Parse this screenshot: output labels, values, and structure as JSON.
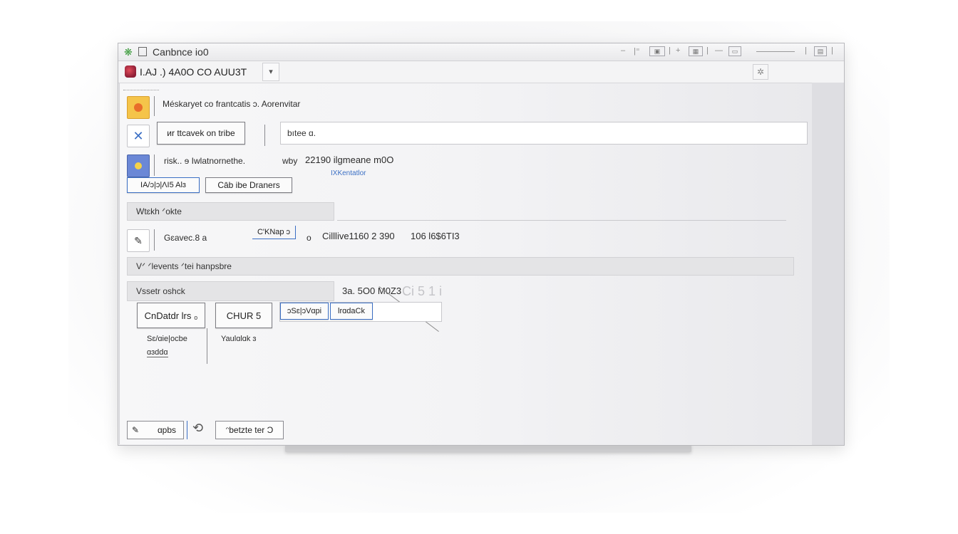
{
  "window": {
    "title": "Canbnce io0"
  },
  "addressbar": {
    "text": "I.AJ .) 4A0O  CO AUU3T",
    "dropdown_glyph": "▾",
    "settings_glyph": "✲"
  },
  "rows": {
    "heading": "Méskaryet co frantcatis ɔ. Aorenvitar",
    "search": {
      "button_label": "ᴎr ttcavek on tribe",
      "field_value": "bıtee ɑ."
    },
    "info": {
      "label": "risk..  ɘ  Iwlatnornethe.",
      "by": "wby",
      "number": "22190  ilgmeane m0O",
      "link": "IXKentatlor",
      "button_left": "IA/ɔ|ɔ|ɅI5  Alɜ",
      "button_right": "Cāb ibe Draners"
    },
    "section1": "Wtɛkh ᐟokte",
    "line": {
      "label": "Gɛavec.8 a",
      "code": "C'ΚΝap ɔ",
      "sep": "o",
      "value": "Cilllive1160 2 390",
      "value2": "106  l6$6TI3"
    },
    "section2": "Vᐟ  ᐟlevents  ᐟtei hanpsbre",
    "section3": "Vssetr oshck",
    "amount": "3a.  5O0  M0Z3",
    "amount_ghost": "Ci 5 1 i",
    "buttons": {
      "cond": "CnDatdr lrs ₀",
      "chk": "CHUR 5",
      "seg1": "ɔSɛ|ɔVɑpi",
      "seg2": "lrɑdaCk"
    },
    "sub": {
      "left_line1": "Sɛ/ɑie|ocbe",
      "left_line2": "ɑɜddɑ",
      "right": "Yaulɑlɑk ɜ"
    }
  },
  "footer": {
    "btn1": "ɑpbs",
    "btn2": "ᵔbetzte ter Ɔ"
  },
  "colors": {
    "accent_orange": "#f2a030",
    "accent_blue": "#3b6fc4",
    "green": "#3a9a3a",
    "red": "#b5283c"
  },
  "icons": {
    "titlebar_app": "app-leaf-icon",
    "address": "red-badge-icon",
    "row1": "warning-icon",
    "row2": "close-icon",
    "row3": "lightbulb-icon",
    "row4": "edit-icon",
    "footer1": "pencil-icon",
    "footer_mid": "refresh-icon"
  }
}
